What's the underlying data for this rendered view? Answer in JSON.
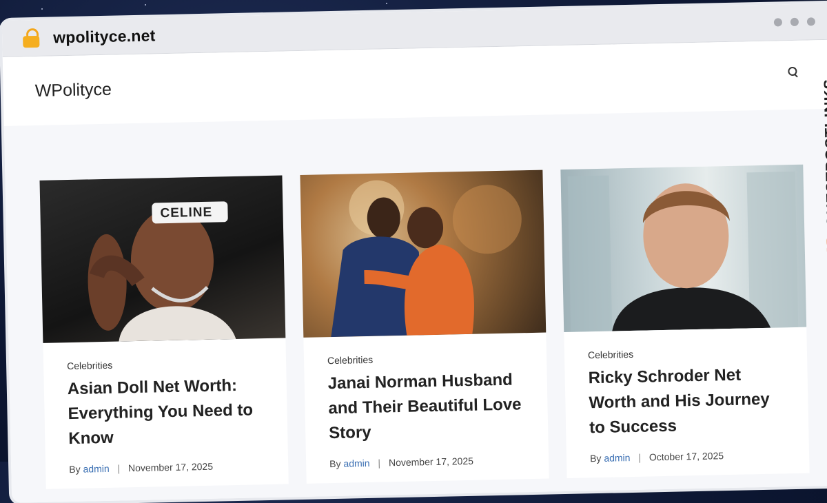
{
  "browser": {
    "url": "wpolityce.net"
  },
  "site": {
    "title": "WPolityce"
  },
  "side_brand": {
    "text": "GUESTPOSTLINKS"
  },
  "posts": [
    {
      "category": "Celebrities",
      "title": "Asian Doll Net Worth: Everything You Need to Know",
      "by": "By",
      "author": "admin",
      "separator": "|",
      "date": "November 17, 2025",
      "image_text": "CELINE"
    },
    {
      "category": "Celebrities",
      "title": "Janai Norman Husband and Their Beautiful Love Story",
      "by": "By",
      "author": "admin",
      "separator": "|",
      "date": "November 17, 2025"
    },
    {
      "category": "Celebrities",
      "title": "Ricky Schroder Net Worth and His Journey to Success",
      "by": "By",
      "author": "admin",
      "separator": "|",
      "date": "October 17, 2025"
    }
  ],
  "colors": {
    "author_link": "#3a6fb3",
    "brand_accent": "#ee6b2f",
    "lock": "#f5ae1f"
  },
  "icons": [
    "lock-icon",
    "search-icon",
    "link-icon"
  ]
}
